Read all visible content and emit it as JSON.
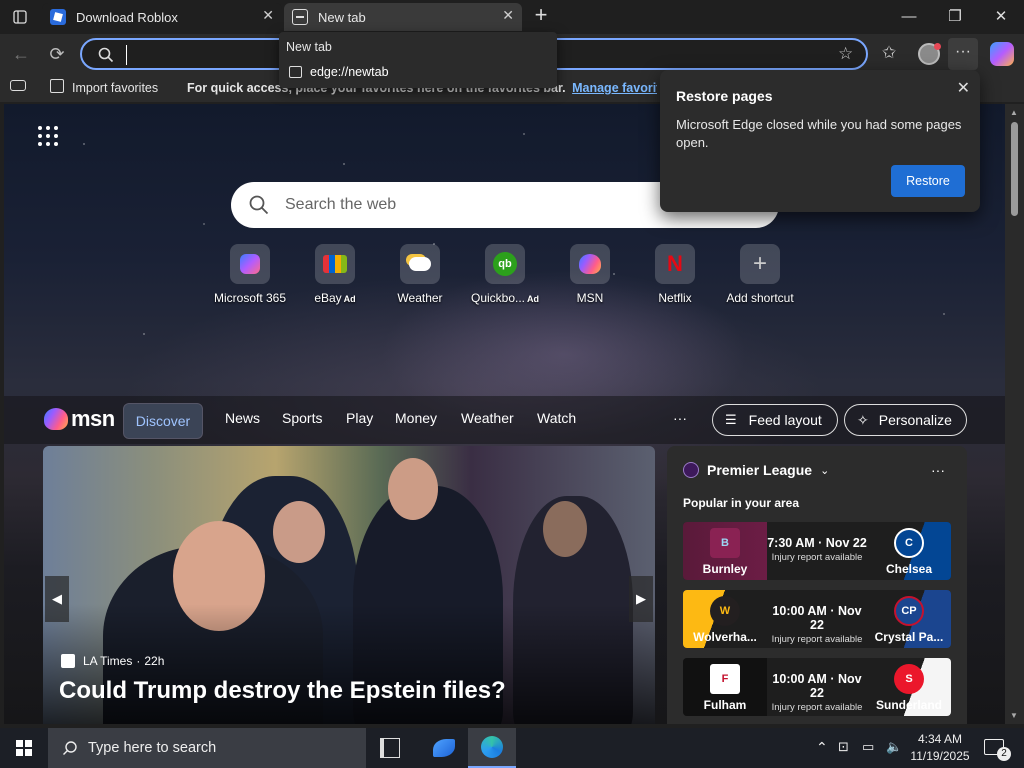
{
  "tabs": [
    {
      "title": "Download Roblox",
      "icon": "roblox-icon",
      "active": false
    },
    {
      "title": "New tab",
      "icon": "newtab-icon",
      "active": true
    }
  ],
  "address": {
    "value": "",
    "placeholder": ""
  },
  "omnibox_dropdown": {
    "header": "New tab",
    "suggestion": "edge://newtab"
  },
  "favorites_bar": {
    "import_label": "Import favorites",
    "hint_prefix": "For quick access, place your favorites here on the favorites bar.",
    "manage_link": "Manage favorites now"
  },
  "restore_popup": {
    "title": "Restore pages",
    "body": "Microsoft Edge closed while you had some pages open.",
    "button": "Restore"
  },
  "search": {
    "placeholder": "Search the web"
  },
  "quick_links": [
    {
      "label": "Microsoft 365",
      "ad": "",
      "icon": "m365-icon",
      "color": "#6b5bd6"
    },
    {
      "label": "eBay",
      "ad": "Ad",
      "icon": "ebay-icon",
      "color": "#e53238"
    },
    {
      "label": "Weather",
      "ad": "",
      "icon": "weather-icon",
      "color": "#f5c542"
    },
    {
      "label": "Quickbo...",
      "ad": "Ad",
      "icon": "quickbooks-icon",
      "color": "#2ca01c"
    },
    {
      "label": "MSN",
      "ad": "",
      "icon": "msn-icon",
      "color": "#1a73e8"
    },
    {
      "label": "Netflix",
      "ad": "",
      "icon": "netflix-icon",
      "color": "#e50914"
    },
    {
      "label": "Add shortcut",
      "ad": "",
      "icon": "plus-icon",
      "color": "#cccccc"
    }
  ],
  "msn": {
    "logo": "msn",
    "tabs": [
      "Discover",
      "News",
      "Sports",
      "Play",
      "Money",
      "Weather",
      "Watch"
    ],
    "active_tab": "Discover",
    "more": "···",
    "feed_layout": "Feed layout",
    "personalize": "Personalize"
  },
  "hero": {
    "source": "LA Times",
    "age": "22h",
    "headline": "Could Trump destroy the Epstein files?"
  },
  "sports": {
    "league": "Premier League",
    "subtitle": "Popular in your area",
    "matches": [
      {
        "home": "Burnley",
        "away": "Chelsea",
        "time": "7:30 AM · Nov 22",
        "status": "Injury report available",
        "home_color": "#6c1d45",
        "away_color": "#034694"
      },
      {
        "home": "Wolverha...",
        "away": "Crystal Pa...",
        "time": "10:00 AM · Nov 22",
        "status": "Injury report available",
        "home_color": "#fdb913",
        "away_color": "#1b458f"
      },
      {
        "home": "Fulham",
        "away": "Sunderland",
        "time": "10:00 AM · Nov 22",
        "status": "Injury report available",
        "home_color": "#000000",
        "away_color": "#eb172b"
      }
    ]
  },
  "taskbar": {
    "search_placeholder": "Type here to search",
    "time": "4:34 AM",
    "date": "11/19/2025",
    "notifications": "2"
  }
}
